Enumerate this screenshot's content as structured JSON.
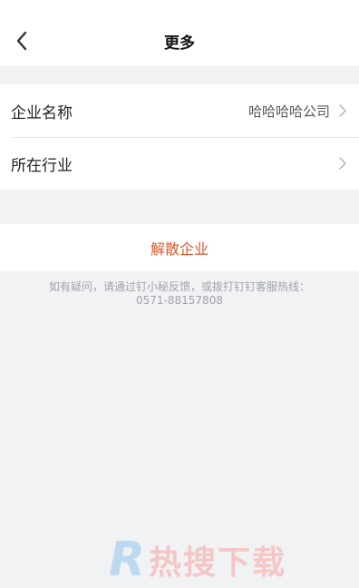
{
  "header": {
    "title": "更多"
  },
  "settings": [
    {
      "label": "企业名称",
      "value": "哈哈哈哈公司"
    },
    {
      "label": "所在行业",
      "value": ""
    }
  ],
  "actions": {
    "dissolve_label": "解散企业"
  },
  "help": {
    "line1": "如有疑问，请通过钉小秘反馈，或拨打钉钉客服热线：",
    "line2": "0571-88157808"
  },
  "watermark": {
    "letter": "R",
    "text": "热搜下载"
  },
  "colors": {
    "danger": "#d9572f",
    "background": "#f1f2f4"
  }
}
